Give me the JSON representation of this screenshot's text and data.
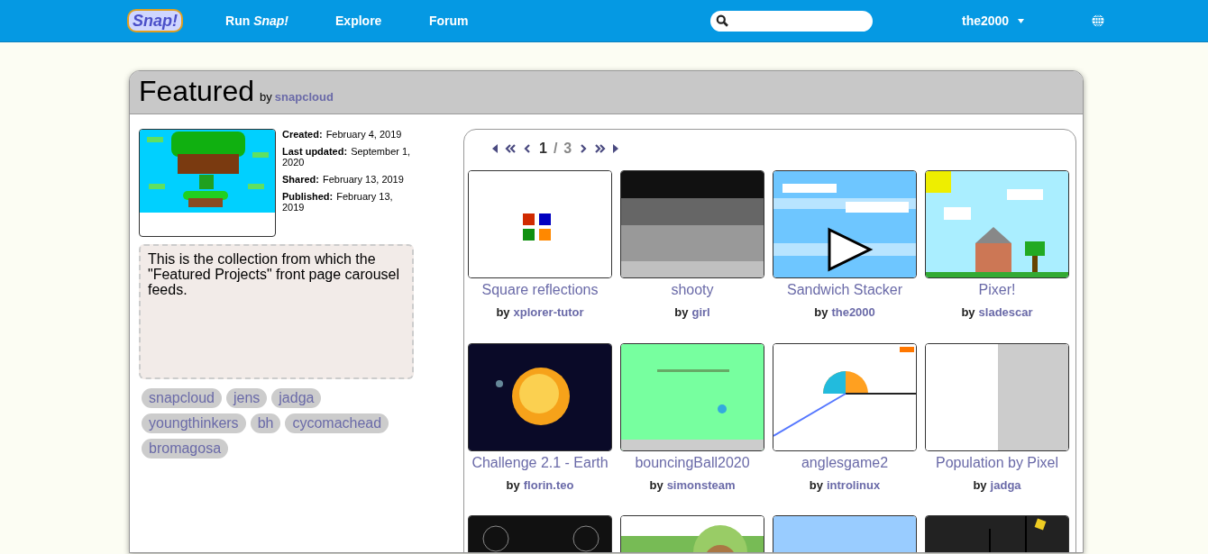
{
  "nav": {
    "logo": "Snap!",
    "links": [
      {
        "label": "Run *Snap!*"
      },
      {
        "label": "Explore"
      },
      {
        "label": "Forum"
      }
    ],
    "user": "the2000"
  },
  "collection": {
    "title": "Featured",
    "by": "by",
    "author": "snapcloud",
    "meta": [
      {
        "label": "Created:",
        "value": "February 4, 2019"
      },
      {
        "label": "Last updated:",
        "value": "September 1, 2020"
      },
      {
        "label": "Shared:",
        "value": "February 13, 2019"
      },
      {
        "label": "Published:",
        "value": "February 13, 2019"
      }
    ],
    "description": "This is the collection from which the \"Featured Projects\" front page carousel feeds.",
    "editors": [
      "snapcloud",
      "jens",
      "jadga",
      "youngthinkers",
      "bh",
      "cycomachead",
      "bromagosa"
    ]
  },
  "pagination": {
    "current": "1",
    "separator": "/",
    "total": "3"
  },
  "projects": [
    {
      "title": "Square reflections",
      "by": "by",
      "author": "xplorer-tutor"
    },
    {
      "title": "shooty",
      "by": "by",
      "author": "girl"
    },
    {
      "title": "Sandwich Stacker",
      "by": "by",
      "author": "the2000"
    },
    {
      "title": "Pixer!",
      "by": "by",
      "author": "sladescar"
    },
    {
      "title": "Challenge 2.1 - Earth",
      "by": "by",
      "author": "florin.teo"
    },
    {
      "title": "bouncingBall2020",
      "by": "by",
      "author": "simonsteam"
    },
    {
      "title": "anglesgame2",
      "by": "by",
      "author": "introlinux"
    },
    {
      "title": "Population by Pixel",
      "by": "by",
      "author": "jadga"
    }
  ]
}
